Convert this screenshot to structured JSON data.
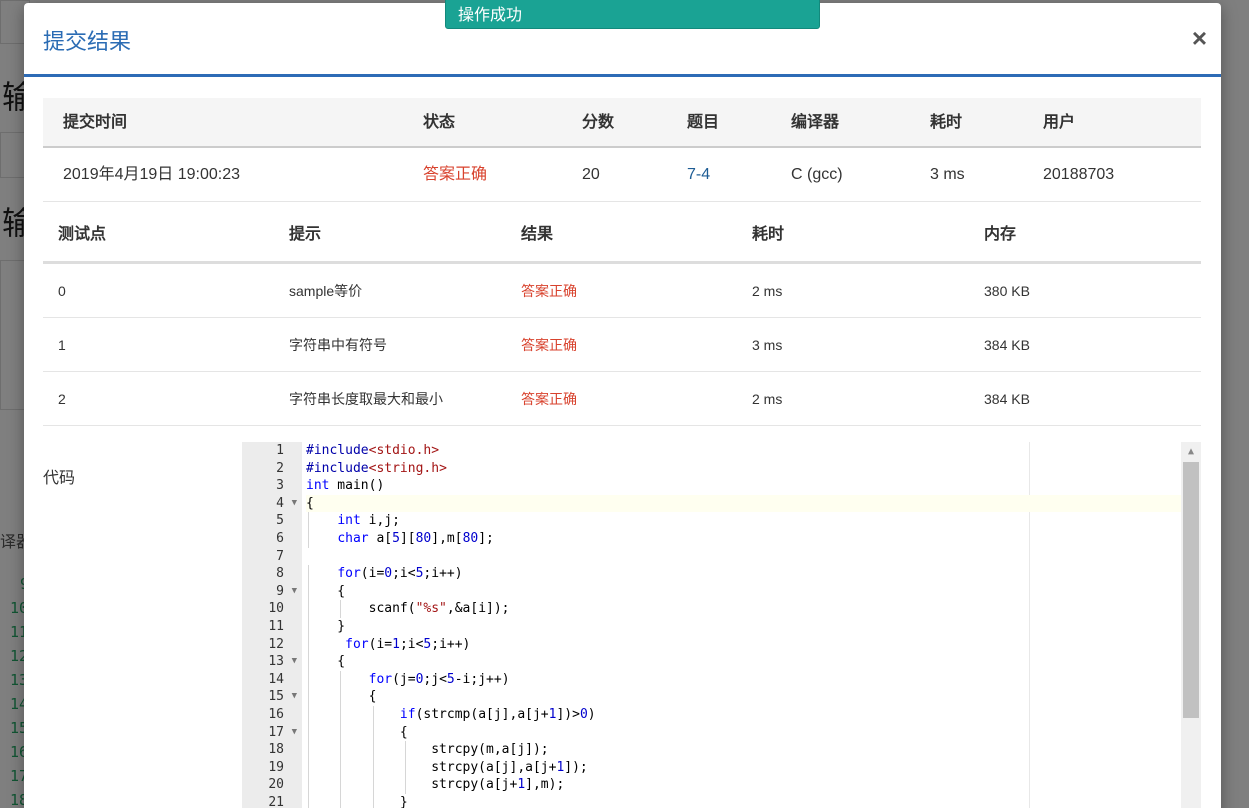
{
  "toast": {
    "message": "操作成功"
  },
  "modal": {
    "title": "提交结果",
    "close": "×"
  },
  "background": {
    "heading1": "输",
    "heading2": "输",
    "side_label": "译器",
    "line_numbers": [
      "9",
      "10",
      "11",
      "12",
      "13",
      "14",
      "15",
      "16",
      "17",
      "18"
    ]
  },
  "summary": {
    "headers": [
      "提交时间",
      "状态",
      "分数",
      "题目",
      "编译器",
      "耗时",
      "用户"
    ],
    "row": {
      "time": "2019年4月19日 19:00:23",
      "status": "答案正确",
      "score": "20",
      "problem": "7-4",
      "compiler": "C (gcc)",
      "elapsed": "3 ms",
      "user": "20188703"
    }
  },
  "tests": {
    "headers": [
      "测试点",
      "提示",
      "结果",
      "耗时",
      "内存"
    ],
    "rows": [
      {
        "id": "0",
        "hint": "sample等价",
        "result": "答案正确",
        "time": "2 ms",
        "memory": "380 KB"
      },
      {
        "id": "1",
        "hint": "字符串中有符号",
        "result": "答案正确",
        "time": "3 ms",
        "memory": "384 KB"
      },
      {
        "id": "2",
        "hint": "字符串长度取最大和最小",
        "result": "答案正确",
        "time": "2 ms",
        "memory": "384 KB"
      }
    ]
  },
  "code": {
    "label": "代码",
    "lines": [
      "#include<stdio.h>",
      "#include<string.h>",
      "int main()",
      "{",
      "    int i,j;",
      "    char a[5][80],m[80];",
      "",
      "    for(i=0;i<5;i++)",
      "    {",
      "        scanf(\"%s\",&a[i]);",
      "    }",
      "     for(i=1;i<5;i++)",
      "    {",
      "        for(j=0;j<5-i;j++)",
      "        {",
      "            if(strcmp(a[j],a[j+1])>0)",
      "            {",
      "                strcpy(m,a[j]);",
      "                strcpy(a[j],a[j+1]);",
      "                strcpy(a[j+1],m);",
      "            }"
    ],
    "fold_lines": [
      4,
      9,
      13,
      15,
      17
    ]
  }
}
